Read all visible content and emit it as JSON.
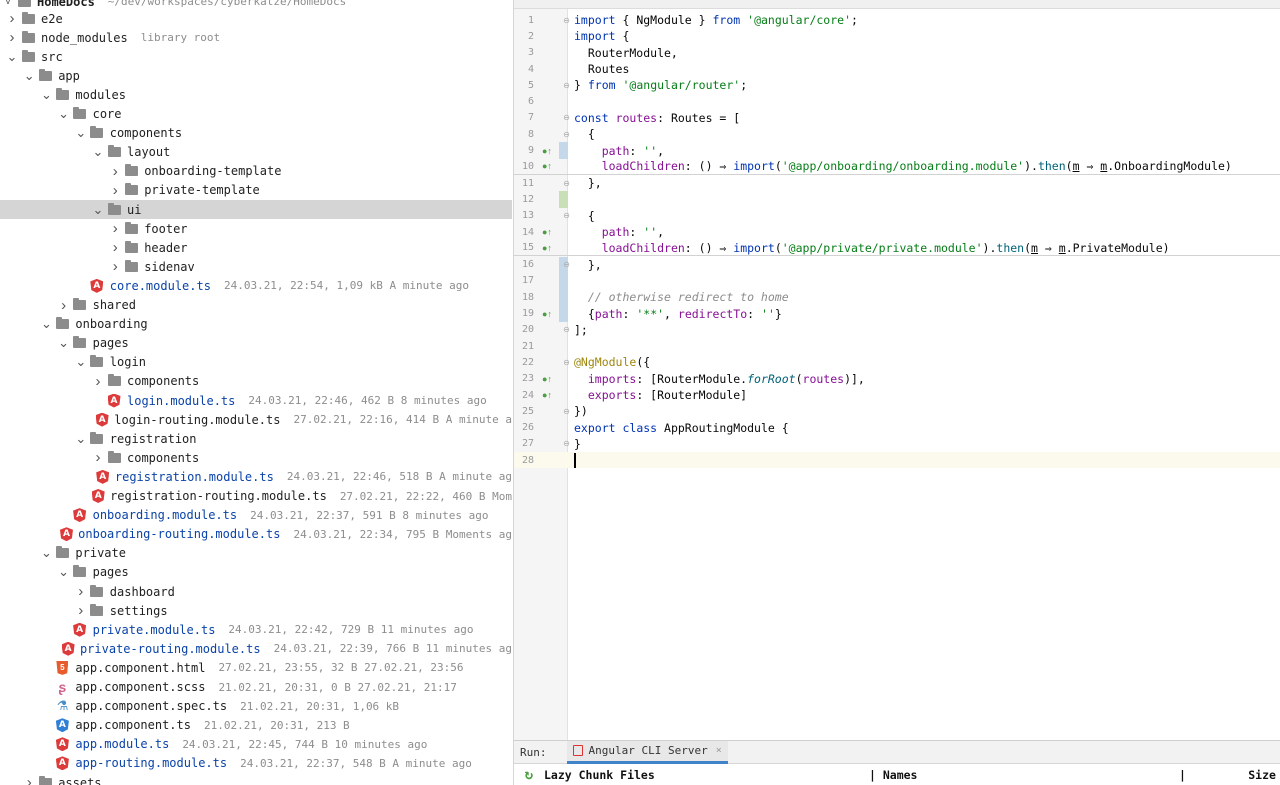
{
  "tree": {
    "header": {
      "name": "HomeDocs",
      "path": "~/dev/workspaces/cyberkatze/HomeDocs"
    },
    "items": [
      {
        "depth": 0,
        "chev": ">",
        "icon": "folder-icon",
        "label": "e2e",
        "meta": ""
      },
      {
        "depth": 0,
        "chev": ">",
        "icon": "folder-icon",
        "label": "node_modules",
        "meta": "library root"
      },
      {
        "depth": 0,
        "chev": "v",
        "icon": "folder-icon",
        "label": "src",
        "meta": ""
      },
      {
        "depth": 1,
        "chev": "v",
        "icon": "folder-icon",
        "label": "app",
        "meta": ""
      },
      {
        "depth": 2,
        "chev": "v",
        "icon": "folder-icon",
        "label": "modules",
        "meta": ""
      },
      {
        "depth": 3,
        "chev": "v",
        "icon": "folder-icon",
        "label": "core",
        "meta": ""
      },
      {
        "depth": 4,
        "chev": "v",
        "icon": "folder-icon",
        "label": "components",
        "meta": ""
      },
      {
        "depth": 5,
        "chev": "v",
        "icon": "folder-icon",
        "label": "layout",
        "meta": ""
      },
      {
        "depth": 6,
        "chev": ">",
        "icon": "folder-icon",
        "label": "onboarding-template",
        "meta": ""
      },
      {
        "depth": 6,
        "chev": ">",
        "icon": "folder-icon",
        "label": "private-template",
        "meta": ""
      },
      {
        "depth": 5,
        "chev": "v",
        "icon": "folder-icon",
        "label": "ui",
        "meta": "",
        "selected": true
      },
      {
        "depth": 6,
        "chev": ">",
        "icon": "folder-icon",
        "label": "footer",
        "meta": ""
      },
      {
        "depth": 6,
        "chev": ">",
        "icon": "folder-icon",
        "label": "header",
        "meta": ""
      },
      {
        "depth": 6,
        "chev": ">",
        "icon": "folder-icon",
        "label": "sidenav",
        "meta": ""
      },
      {
        "depth": 4,
        "chev": "",
        "icon": "angular-icon",
        "label": "core.module.ts",
        "meta": "24.03.21, 22:54, 1,09 kB A minute ago",
        "mod": true
      },
      {
        "depth": 3,
        "chev": ">",
        "icon": "folder-icon",
        "label": "shared",
        "meta": ""
      },
      {
        "depth": 2,
        "chev": "v",
        "icon": "folder-icon",
        "label": "onboarding",
        "meta": ""
      },
      {
        "depth": 3,
        "chev": "v",
        "icon": "folder-icon",
        "label": "pages",
        "meta": ""
      },
      {
        "depth": 4,
        "chev": "v",
        "icon": "folder-icon",
        "label": "login",
        "meta": ""
      },
      {
        "depth": 5,
        "chev": ">",
        "icon": "folder-icon",
        "label": "components",
        "meta": ""
      },
      {
        "depth": 5,
        "chev": "",
        "icon": "angular-icon",
        "label": "login.module.ts",
        "meta": "24.03.21, 22:46, 462 B 8 minutes ago",
        "mod": true
      },
      {
        "depth": 5,
        "chev": "",
        "icon": "angular-icon",
        "label": "login-routing.module.ts",
        "meta": "27.02.21, 22:16, 414 B A minute a"
      },
      {
        "depth": 4,
        "chev": "v",
        "icon": "folder-icon",
        "label": "registration",
        "meta": ""
      },
      {
        "depth": 5,
        "chev": ">",
        "icon": "folder-icon",
        "label": "components",
        "meta": ""
      },
      {
        "depth": 5,
        "chev": "",
        "icon": "angular-icon",
        "label": "registration.module.ts",
        "meta": "24.03.21, 22:46, 518 B A minute ag",
        "mod": true
      },
      {
        "depth": 5,
        "chev": "",
        "icon": "angular-icon",
        "label": "registration-routing.module.ts",
        "meta": "27.02.21, 22:22, 460 B Mom"
      },
      {
        "depth": 3,
        "chev": "",
        "icon": "angular-icon",
        "label": "onboarding.module.ts",
        "meta": "24.03.21, 22:37, 591 B 8 minutes ago",
        "mod": true
      },
      {
        "depth": 3,
        "chev": "",
        "icon": "angular-icon",
        "label": "onboarding-routing.module.ts",
        "meta": "24.03.21, 22:34, 795 B Moments ag",
        "mod": true
      },
      {
        "depth": 2,
        "chev": "v",
        "icon": "folder-icon",
        "label": "private",
        "meta": ""
      },
      {
        "depth": 3,
        "chev": "v",
        "icon": "folder-icon",
        "label": "pages",
        "meta": ""
      },
      {
        "depth": 4,
        "chev": ">",
        "icon": "folder-icon",
        "label": "dashboard",
        "meta": ""
      },
      {
        "depth": 4,
        "chev": ">",
        "icon": "folder-icon",
        "label": "settings",
        "meta": ""
      },
      {
        "depth": 3,
        "chev": "",
        "icon": "angular-icon",
        "label": "private.module.ts",
        "meta": "24.03.21, 22:42, 729 B 11 minutes ago",
        "mod": true
      },
      {
        "depth": 3,
        "chev": "",
        "icon": "angular-icon",
        "label": "private-routing.module.ts",
        "meta": "24.03.21, 22:39, 766 B 11 minutes ag",
        "mod": true
      },
      {
        "depth": 2,
        "chev": "",
        "icon": "html5-icon",
        "label": "app.component.html",
        "meta": "27.02.21, 23:55, 32 B 27.02.21, 23:56"
      },
      {
        "depth": 2,
        "chev": "",
        "icon": "scss-icon",
        "label": "app.component.scss",
        "meta": "21.02.21, 20:31, 0 B 27.02.21, 21:17"
      },
      {
        "depth": 2,
        "chev": "",
        "icon": "test-flask-icon",
        "label": "app.component.spec.ts",
        "meta": "21.02.21, 20:31, 1,06 kB"
      },
      {
        "depth": 2,
        "chev": "",
        "icon": "angular-component-icon",
        "label": "app.component.ts",
        "meta": "21.02.21, 20:31, 213 B"
      },
      {
        "depth": 2,
        "chev": "",
        "icon": "angular-icon",
        "label": "app.module.ts",
        "meta": "24.03.21, 22:45, 744 B 10 minutes ago",
        "mod": true
      },
      {
        "depth": 2,
        "chev": "",
        "icon": "angular-icon",
        "label": "app-routing.module.ts",
        "meta": "24.03.21, 22:37, 548 B A minute ago",
        "mod": true
      },
      {
        "depth": 1,
        "chev": ">",
        "icon": "folder-icon",
        "label": "assets",
        "meta": ""
      }
    ]
  },
  "editor": {
    "lines": [
      {
        "n": "1",
        "fold": "⊖",
        "tokens": [
          [
            "import",
            "kw"
          ],
          [
            " { ",
            "p"
          ],
          [
            "NgModule",
            "ty"
          ],
          [
            " } ",
            "p"
          ],
          [
            "from",
            "kw"
          ],
          [
            " ",
            "p"
          ],
          [
            "'@angular/core'",
            "str"
          ],
          [
            ";",
            "p"
          ]
        ]
      },
      {
        "n": "2",
        "tokens": [
          [
            "import",
            "kw"
          ],
          [
            " {",
            "p"
          ]
        ]
      },
      {
        "n": "3",
        "tokens": [
          [
            "  RouterModule,",
            "p"
          ]
        ]
      },
      {
        "n": "4",
        "tokens": [
          [
            "  Routes",
            "p"
          ]
        ]
      },
      {
        "n": "5",
        "fold": "⊖",
        "tokens": [
          [
            "} ",
            "p"
          ],
          [
            "from",
            "kw"
          ],
          [
            " ",
            "p"
          ],
          [
            "'@angular/router'",
            "str"
          ],
          [
            ";",
            "p"
          ]
        ]
      },
      {
        "n": "6",
        "tokens": []
      },
      {
        "n": "7",
        "fold": "⊖",
        "tokens": [
          [
            "const",
            "kw"
          ],
          [
            " ",
            "p"
          ],
          [
            "routes",
            "var"
          ],
          [
            ": Routes = [",
            "p"
          ]
        ]
      },
      {
        "n": "8",
        "fold": "⊖",
        "tokens": [
          [
            "  {",
            "p"
          ]
        ]
      },
      {
        "n": "9",
        "mark": "●↑",
        "bar": "mod",
        "tokens": [
          [
            "    ",
            "p"
          ],
          [
            "path",
            "prop"
          ],
          [
            ": ",
            "p"
          ],
          [
            "''",
            "str"
          ],
          [
            ",",
            "p"
          ]
        ]
      },
      {
        "n": "10",
        "mark": "●↑",
        "sep": true,
        "tokens": [
          [
            "    ",
            "p"
          ],
          [
            "loadChildren",
            "prop"
          ],
          [
            ": () ⇒ ",
            "p"
          ],
          [
            "import",
            "kw"
          ],
          [
            "(",
            "p"
          ],
          [
            "'@app/onboarding/onboarding.module'",
            "str"
          ],
          [
            ").",
            "p"
          ],
          [
            "then",
            "fn"
          ],
          [
            "(",
            "p"
          ],
          [
            "m",
            "u"
          ],
          [
            " ⇒ ",
            "p"
          ],
          [
            "m",
            "u"
          ],
          [
            ".OnboardingModule)",
            "p"
          ]
        ]
      },
      {
        "n": "11",
        "fold": "⊖",
        "tokens": [
          [
            "  },",
            "p"
          ]
        ]
      },
      {
        "n": "12",
        "bar": "add",
        "tokens": []
      },
      {
        "n": "13",
        "fold": "⊖",
        "tokens": [
          [
            "  {",
            "p"
          ]
        ]
      },
      {
        "n": "14",
        "mark": "●↑",
        "tokens": [
          [
            "    ",
            "p"
          ],
          [
            "path",
            "prop"
          ],
          [
            ": ",
            "p"
          ],
          [
            "''",
            "str"
          ],
          [
            ",",
            "p"
          ]
        ]
      },
      {
        "n": "15",
        "mark": "●↑",
        "sep": true,
        "tokens": [
          [
            "    ",
            "p"
          ],
          [
            "loadChildren",
            "prop"
          ],
          [
            ": () ⇒ ",
            "p"
          ],
          [
            "import",
            "kw"
          ],
          [
            "(",
            "p"
          ],
          [
            "'@app/private/private.module'",
            "str"
          ],
          [
            ").",
            "p"
          ],
          [
            "then",
            "fn"
          ],
          [
            "(",
            "p"
          ],
          [
            "m",
            "u"
          ],
          [
            " ⇒ ",
            "p"
          ],
          [
            "m",
            "u"
          ],
          [
            ".PrivateModule)",
            "p"
          ]
        ]
      },
      {
        "n": "16",
        "bar": "mod",
        "fold": "⊖",
        "tokens": [
          [
            "  },",
            "p"
          ]
        ]
      },
      {
        "n": "17",
        "bar": "mod",
        "tokens": []
      },
      {
        "n": "18",
        "bar": "mod",
        "tokens": [
          [
            "  // otherwise redirect to home",
            "cm"
          ]
        ]
      },
      {
        "n": "19",
        "mark": "●↑",
        "bar": "mod",
        "tokens": [
          [
            "  {",
            "p"
          ],
          [
            "path",
            "prop"
          ],
          [
            ": ",
            "p"
          ],
          [
            "'**'",
            "str"
          ],
          [
            ", ",
            "p"
          ],
          [
            "redirectTo",
            "prop"
          ],
          [
            ": ",
            "p"
          ],
          [
            "''",
            "str"
          ],
          [
            "}",
            "p"
          ]
        ]
      },
      {
        "n": "20",
        "fold": "⊖",
        "tokens": [
          [
            "];",
            "p"
          ]
        ]
      },
      {
        "n": "21",
        "tokens": []
      },
      {
        "n": "22",
        "fold": "⊖",
        "tokens": [
          [
            "@NgModule",
            "dec"
          ],
          [
            "({",
            "p"
          ]
        ]
      },
      {
        "n": "23",
        "mark": "●↑",
        "tokens": [
          [
            "  ",
            "p"
          ],
          [
            "imports",
            "prop"
          ],
          [
            ": [RouterModule.",
            "p"
          ],
          [
            "forRoot",
            "it"
          ],
          [
            "(",
            "p"
          ],
          [
            "routes",
            "var"
          ],
          [
            ")],",
            "p"
          ]
        ]
      },
      {
        "n": "24",
        "mark": "●↑",
        "tokens": [
          [
            "  ",
            "p"
          ],
          [
            "exports",
            "prop"
          ],
          [
            ": [RouterModule]",
            "p"
          ]
        ]
      },
      {
        "n": "25",
        "fold": "⊖",
        "tokens": [
          [
            "})",
            "p"
          ]
        ]
      },
      {
        "n": "26",
        "tokens": [
          [
            "export",
            "kw"
          ],
          [
            " ",
            "p"
          ],
          [
            "class",
            "kw"
          ],
          [
            " AppRoutingModule {",
            "p"
          ]
        ]
      },
      {
        "n": "27",
        "fold": "⊖",
        "tokens": [
          [
            "}",
            "p"
          ]
        ]
      },
      {
        "n": "28",
        "current": true,
        "caret": true,
        "tokens": []
      }
    ]
  },
  "run": {
    "label": "Run:",
    "tab_label": "Angular CLI Server",
    "close": "×",
    "rerun": "↻",
    "col_files": "Lazy Chunk Files",
    "col_names": "| Names",
    "col_sep": "|",
    "col_size": "Size"
  },
  "colors": {
    "kw": "#0033b3",
    "str": "#067d17",
    "prop": "#871094",
    "var": "#871094",
    "fn": "#00627a",
    "cm": "#8c8c8c",
    "dec": "#9e880d",
    "ty": "#000000",
    "p": "#080808",
    "it": "#00627a",
    "u": "#080808"
  }
}
